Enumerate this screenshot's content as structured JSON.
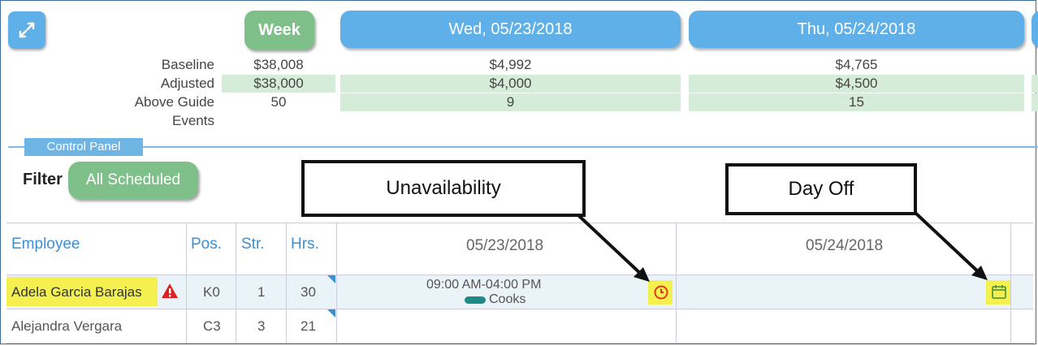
{
  "header": {
    "expand_icon": "expand-icon",
    "week_label": "Week",
    "days": [
      "Wed, 05/23/2018",
      "Thu, 05/24/2018"
    ]
  },
  "metrics": {
    "labels": {
      "baseline": "Baseline",
      "adjusted": "Adjusted",
      "above_guide": "Above Guide",
      "events": "Events"
    },
    "week": {
      "baseline": "$38,008",
      "adjusted": "$38,000",
      "above_guide": "50"
    },
    "day1": {
      "baseline": "$4,992",
      "adjusted": "$4,000",
      "above_guide": "9"
    },
    "day2": {
      "baseline": "$4,765",
      "adjusted": "$4,500",
      "above_guide": "15"
    }
  },
  "control_panel": {
    "tab_label": "Control Panel",
    "filter_label": "Filter",
    "filter_value": "All Scheduled"
  },
  "callouts": {
    "unavailability": "Unavailability",
    "day_off": "Day Off"
  },
  "table": {
    "columns": [
      "Employee",
      "Pos.",
      "Str.",
      "Hrs."
    ],
    "dates": [
      "05/23/2018",
      "05/24/2018"
    ],
    "rows": [
      {
        "employee": "Adela Garcia Barajas",
        "pos": "K0",
        "str": "1",
        "hrs": "30",
        "shift_time": "09:00 AM-04:00 PM",
        "shift_role": "Cooks"
      },
      {
        "employee": "Alejandra Vergara",
        "pos": "C3",
        "str": "3",
        "hrs": "21"
      }
    ]
  },
  "colors": {
    "accent_blue": "#5fb0e8",
    "accent_green": "#7fbf8a",
    "highlight": "#f4f050",
    "warning": "#e02020",
    "shift_pill": "#1e8a8a"
  }
}
